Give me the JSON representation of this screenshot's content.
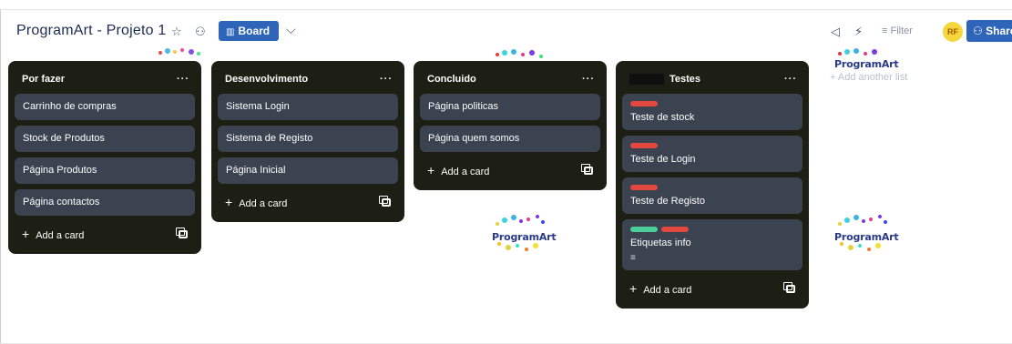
{
  "header": {
    "title": "ProgramArt - Projeto 1",
    "star_icon": "star-icon",
    "workspace_icon": "people-icon",
    "view_button": "Board",
    "view_chevron": "chevron-down-icon",
    "filter_label": "Filter",
    "avatar_initials": "RF",
    "share_label": "Share"
  },
  "logo_text": "ProgramArt",
  "lists": [
    {
      "title": "Por fazer",
      "menu": "···",
      "cards": [
        {
          "title": "Carrinho de compras"
        },
        {
          "title": "Stock de Produtos"
        },
        {
          "title": "Página Produtos"
        },
        {
          "title": "Página contactos"
        }
      ],
      "add_label": "Add a card"
    },
    {
      "title": "Desenvolvimento",
      "menu": "···",
      "cards": [
        {
          "title": "Sistema Login"
        },
        {
          "title": "Sistema de Registo"
        },
        {
          "title": "Página Inicial"
        }
      ],
      "add_label": "Add a card"
    },
    {
      "title": "Concluido",
      "menu": "···",
      "cards": [
        {
          "title": "Página politicas"
        },
        {
          "title": "Página quem somos"
        }
      ],
      "add_label": "Add a card"
    },
    {
      "title": "Testes",
      "menu": "···",
      "cards": [
        {
          "title": "Teste de stock",
          "labels": [
            "#e2483d"
          ]
        },
        {
          "title": "Teste de Login",
          "labels": [
            "#e2483d"
          ]
        },
        {
          "title": "Teste de Registo",
          "labels": [
            "#e2483d"
          ]
        },
        {
          "title": "Etiquetas info",
          "labels": [
            "#4bce97",
            "#e2483d"
          ],
          "has_description": true
        }
      ],
      "add_label": "Add a card"
    }
  ],
  "add_list_label": "Add another list",
  "colors": {
    "list_bg": "#1d1f14",
    "card_bg": "#3b4350",
    "accent": "#2f65b8",
    "label_red": "#e2483d",
    "label_green": "#4bce97"
  }
}
